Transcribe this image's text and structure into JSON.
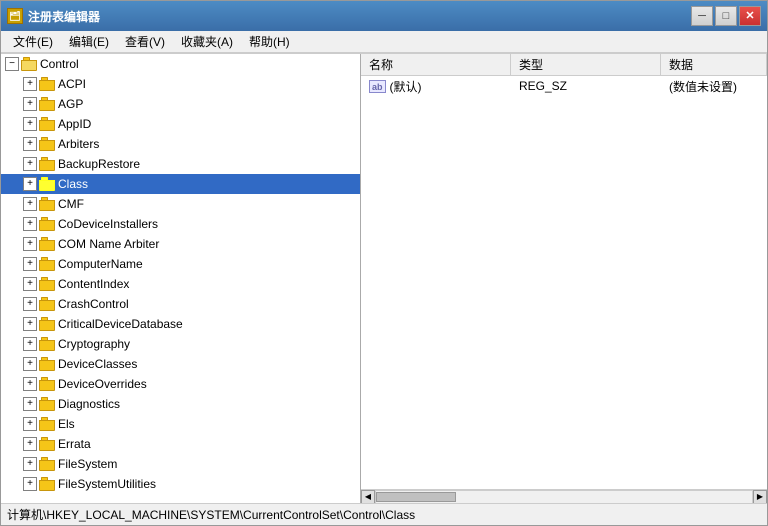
{
  "window": {
    "title": "注册表编辑器",
    "icon": "regedit"
  },
  "title_controls": {
    "minimize": "─",
    "maximize": "□",
    "close": "✕"
  },
  "menu": {
    "items": [
      {
        "label": "文件(E)",
        "key": "file"
      },
      {
        "label": "编辑(E)",
        "key": "edit"
      },
      {
        "label": "查看(V)",
        "key": "view"
      },
      {
        "label": "收藏夹(A)",
        "key": "favorites"
      },
      {
        "label": "帮助(H)",
        "key": "help"
      }
    ]
  },
  "tree": {
    "items": [
      {
        "id": "control",
        "label": "Control",
        "indent": 1,
        "expanded": true,
        "selected": false,
        "has_expand": true,
        "expand_char": "▲"
      },
      {
        "id": "acpi",
        "label": "ACPI",
        "indent": 2,
        "expanded": false,
        "selected": false,
        "has_expand": true,
        "expand_char": "▶"
      },
      {
        "id": "agp",
        "label": "AGP",
        "indent": 2,
        "expanded": false,
        "selected": false,
        "has_expand": true,
        "expand_char": "▶"
      },
      {
        "id": "appid",
        "label": "AppID",
        "indent": 2,
        "expanded": false,
        "selected": false,
        "has_expand": true,
        "expand_char": "▶"
      },
      {
        "id": "arbiters",
        "label": "Arbiters",
        "indent": 2,
        "expanded": false,
        "selected": false,
        "has_expand": true,
        "expand_char": "▶"
      },
      {
        "id": "backuprestore",
        "label": "BackupRestore",
        "indent": 2,
        "expanded": false,
        "selected": false,
        "has_expand": true,
        "expand_char": "▶"
      },
      {
        "id": "class",
        "label": "Class",
        "indent": 2,
        "expanded": false,
        "selected": true,
        "has_expand": true,
        "expand_char": "▶"
      },
      {
        "id": "cmf",
        "label": "CMF",
        "indent": 2,
        "expanded": false,
        "selected": false,
        "has_expand": true,
        "expand_char": "▶"
      },
      {
        "id": "codeviceinstallers",
        "label": "CoDeviceInstallers",
        "indent": 2,
        "expanded": false,
        "selected": false,
        "has_expand": true,
        "expand_char": "▶"
      },
      {
        "id": "comnamearbiter",
        "label": "COM Name Arbiter",
        "indent": 2,
        "expanded": false,
        "selected": false,
        "has_expand": true,
        "expand_char": "▶"
      },
      {
        "id": "computername",
        "label": "ComputerName",
        "indent": 2,
        "expanded": false,
        "selected": false,
        "has_expand": true,
        "expand_char": "▶"
      },
      {
        "id": "contentindex",
        "label": "ContentIndex",
        "indent": 2,
        "expanded": false,
        "selected": false,
        "has_expand": true,
        "expand_char": "▶"
      },
      {
        "id": "crashcontrol",
        "label": "CrashControl",
        "indent": 2,
        "expanded": false,
        "selected": false,
        "has_expand": true,
        "expand_char": "▶"
      },
      {
        "id": "criticaldevicedatabase",
        "label": "CriticalDeviceDatabase",
        "indent": 2,
        "expanded": false,
        "selected": false,
        "has_expand": true,
        "expand_char": "▶"
      },
      {
        "id": "cryptography",
        "label": "Cryptography",
        "indent": 2,
        "expanded": false,
        "selected": false,
        "has_expand": true,
        "expand_char": "▶"
      },
      {
        "id": "deviceclasses",
        "label": "DeviceClasses",
        "indent": 2,
        "expanded": false,
        "selected": false,
        "has_expand": true,
        "expand_char": "▶"
      },
      {
        "id": "deviceoverrides",
        "label": "DeviceOverrides",
        "indent": 2,
        "expanded": false,
        "selected": false,
        "has_expand": true,
        "expand_char": "▶"
      },
      {
        "id": "diagnostics",
        "label": "Diagnostics",
        "indent": 2,
        "expanded": false,
        "selected": false,
        "has_expand": true,
        "expand_char": "▶"
      },
      {
        "id": "els",
        "label": "Els",
        "indent": 2,
        "expanded": false,
        "selected": false,
        "has_expand": true,
        "expand_char": "▶"
      },
      {
        "id": "errata",
        "label": "Errata",
        "indent": 2,
        "expanded": false,
        "selected": false,
        "has_expand": true,
        "expand_char": "▶"
      },
      {
        "id": "filesystem",
        "label": "FileSystem",
        "indent": 2,
        "expanded": false,
        "selected": false,
        "has_expand": true,
        "expand_char": "▶"
      },
      {
        "id": "filesystemutilities",
        "label": "FileSystemUtilities",
        "indent": 2,
        "expanded": false,
        "selected": false,
        "has_expand": true,
        "expand_char": "▶"
      }
    ]
  },
  "columns": {
    "name": "名称",
    "type": "类型",
    "data": "数据"
  },
  "registry_data": [
    {
      "name": "(默认)",
      "type": "REG_SZ",
      "value": "(数值未设置)"
    }
  ],
  "status_bar": {
    "path": "计算机\\HKEY_LOCAL_MACHINE\\SYSTEM\\CurrentControlSet\\Control\\Class"
  }
}
